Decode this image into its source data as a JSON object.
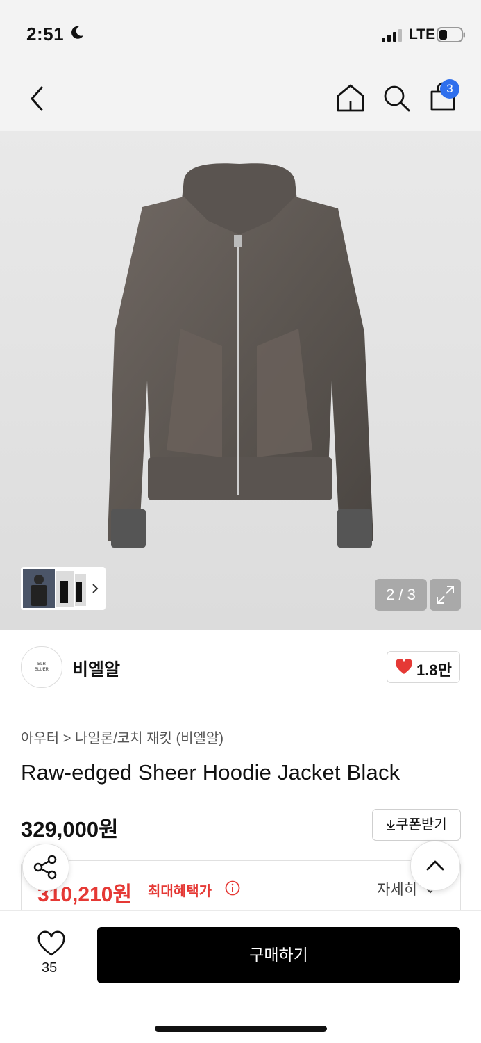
{
  "status_bar": {
    "time": "2:51",
    "network": "LTE"
  },
  "nav": {
    "cart_count": "3"
  },
  "gallery": {
    "counter": "2 / 3"
  },
  "brand": {
    "logo_line1": "BLR",
    "logo_line2": "BLUER",
    "name": "비엘알",
    "likes": "1.8만"
  },
  "product": {
    "category": "아우터 > 나일론/코치 재킷 (비엘알)",
    "title": "Raw-edged Sheer Hoodie Jacket Black",
    "price": "329,000원",
    "coupon_label": "쿠폰받기",
    "max_benefit_price": "310,210원",
    "max_benefit_label": "최대혜택가",
    "detail_label": "자세히"
  },
  "bottom": {
    "wish_count": "35",
    "buy_label": "구매하기"
  },
  "colors": {
    "accent_red": "#e53935",
    "badge_blue": "#2f6fed",
    "buy_button": "#000000"
  }
}
